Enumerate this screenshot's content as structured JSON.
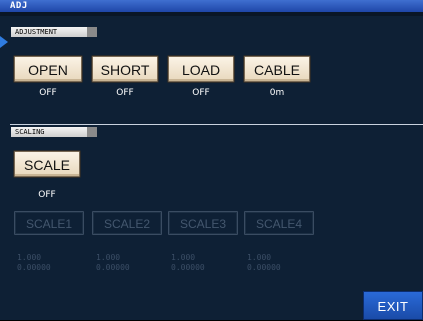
{
  "window": {
    "title": "ADJ"
  },
  "adjustment": {
    "label": "ADJUSTMENT",
    "buttons": [
      {
        "label": "OPEN",
        "status": "OFF"
      },
      {
        "label": "SHORT",
        "status": "OFF"
      },
      {
        "label": "LOAD",
        "status": "OFF"
      },
      {
        "label": "CABLE",
        "status": "0m"
      }
    ]
  },
  "scaling": {
    "label": "SCALING",
    "scale_button": {
      "label": "SCALE",
      "status": "OFF"
    },
    "scale_slots": [
      {
        "label": "SCALE1",
        "value_a": "1.000",
        "value_b": "0.00000"
      },
      {
        "label": "SCALE2",
        "value_a": "1.000",
        "value_b": "0.00000"
      },
      {
        "label": "SCALE3",
        "value_a": "1.000",
        "value_b": "0.00000"
      },
      {
        "label": "SCALE4",
        "value_a": "1.000",
        "value_b": "0.00000"
      }
    ]
  },
  "footer": {
    "exit_label": "EXIT"
  },
  "colors": {
    "accent": "#2a6ad8",
    "button_face": "#fbf3e6",
    "background": "#0e2035"
  }
}
